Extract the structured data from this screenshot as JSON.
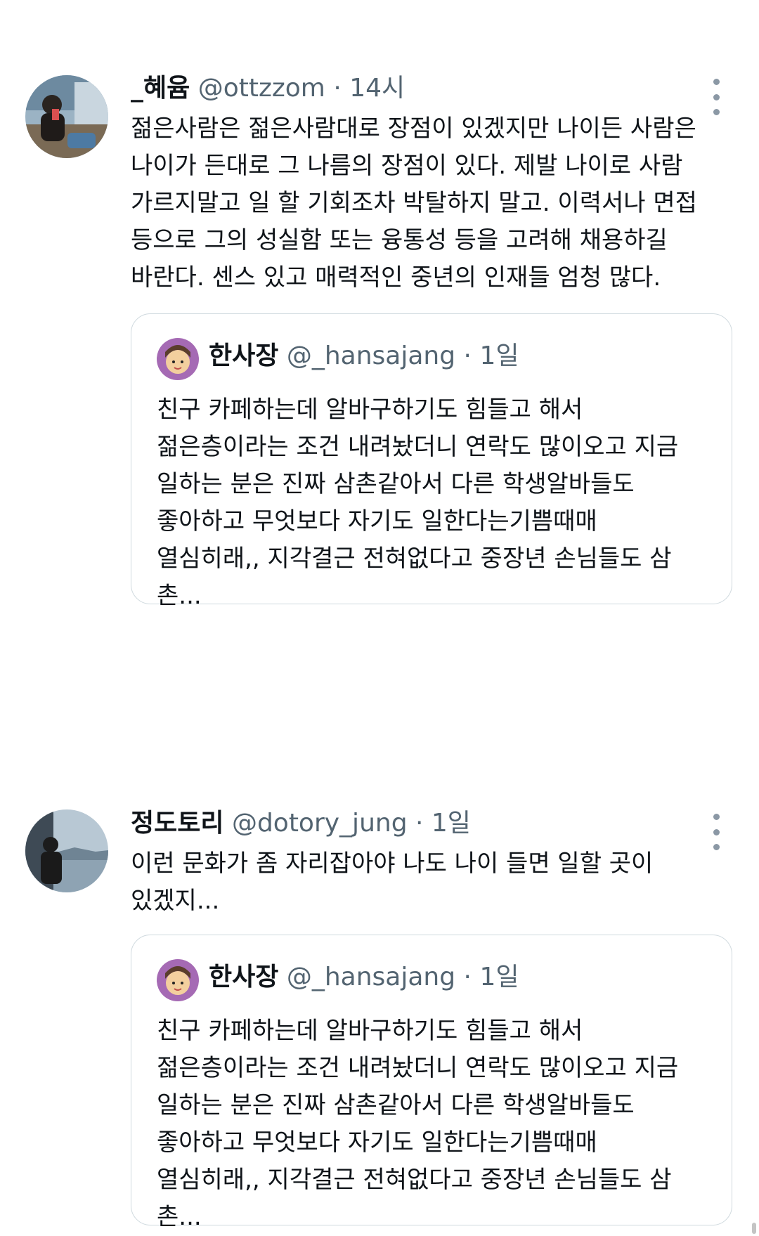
{
  "tweets": [
    {
      "display_name": "_혜윰",
      "handle": "@ottzzom",
      "separator": "·",
      "time": "14시",
      "text": "젊은사람은 젊은사람대로 장점이 있겠지만 나이든 사람은\n나이가 든대로 그 나름의 장점이 있다. 제발 나이로 사람\n가르지말고 일 할 기회조차 박탈하지 말고. 이력서나 면접\n등으로 그의 성실함 또는 융통성 등을 고려해 채용하길\n바란다. 센스 있고 매력적인 중년의 인재들 엄청 많다.",
      "more_icon": "more-vertical-icon",
      "quote": {
        "display_name": "한사장",
        "handle": "@_hansajang",
        "separator": "·",
        "time": "1일",
        "text": "친구 카페하는데 알바구하기도 힘들고 해서\n젊은층이라는 조건 내려놨더니 연락도 많이오고 지금\n일하는 분은 진짜 삼촌같아서 다른 학생알바들도\n좋아하고 무엇보다 자기도 일한다는기쁨때매\n열심히래,, 지각결근 전혀없다고 중장년 손님들도 삼촌..."
      }
    },
    {
      "display_name": "정도토리",
      "handle": "@dotory_jung",
      "separator": "·",
      "time": "1일",
      "text": "이런 문화가 좀 자리잡아야 나도 나이 들면 일할 곳이\n있겠지...",
      "more_icon": "more-vertical-icon",
      "quote": {
        "display_name": "한사장",
        "handle": "@_hansajang",
        "separator": "·",
        "time": "1일",
        "text": "친구 카페하는데 알바구하기도 힘들고 해서\n젊은층이라는 조건 내려놨더니 연락도 많이오고 지금\n일하는 분은 진짜 삼촌같아서 다른 학생알바들도\n좋아하고 무엇보다 자기도 일한다는기쁨때매\n열심히래,, 지각결근 전혀없다고 중장년 손님들도 삼촌..."
      }
    }
  ],
  "colors": {
    "text_primary": "#0f1419",
    "text_secondary": "#536471",
    "border": "#cfd9de"
  }
}
